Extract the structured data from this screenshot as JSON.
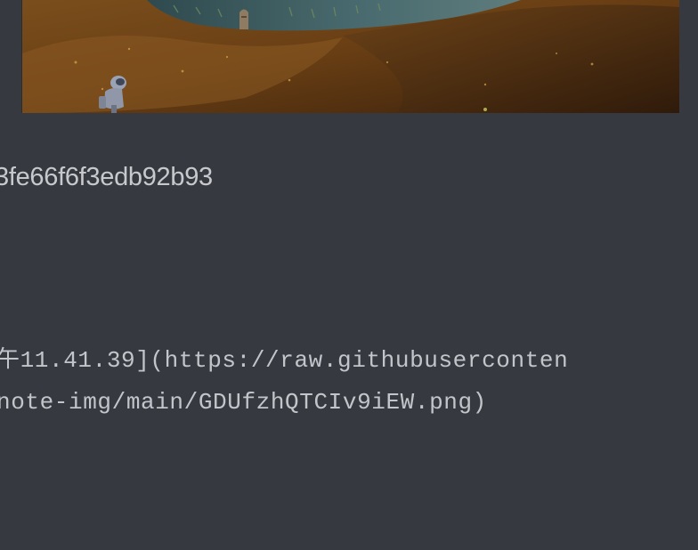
{
  "editor": {
    "image_preview": {
      "alt": "painted landscape with astronaut on a hillside"
    },
    "hash_text": "3fe66f6f3edb92b93",
    "markdown_lines": [
      "午11.41.39](https://raw.githubuserconten",
      "note-img/main/GDUfzhQTCIv9iEW.png)"
    ]
  }
}
